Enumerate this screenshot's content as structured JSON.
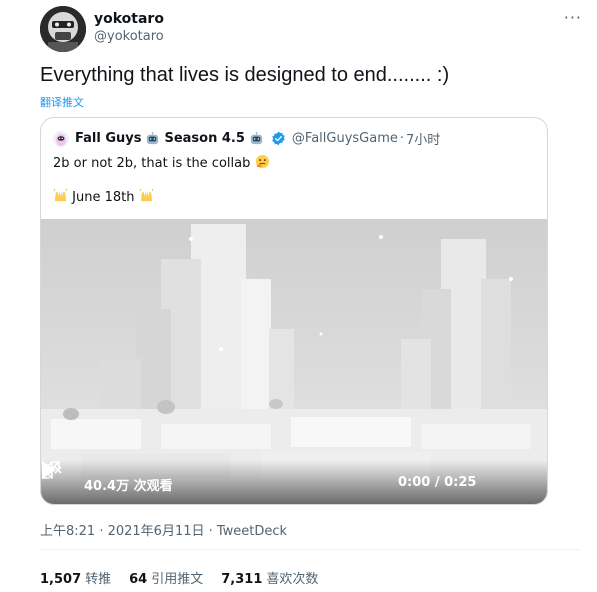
{
  "author": {
    "name": "yokotaro",
    "handle": "@yokotaro",
    "avatar_icon": "mask-avatar-icon",
    "more_icon": "more-dots-icon",
    "more_label": "···"
  },
  "tweet": {
    "text": "Everything that lives is designed to end........ :)",
    "translate_label": "翻译推文"
  },
  "quote": {
    "name_part1": "Fall Guys",
    "name_part2": "Season 4.5",
    "handle": "@FallGuysGame",
    "separator": " · ",
    "time": "7小时",
    "line1": "2b or not 2b, that is the collab",
    "line2": "June 18th",
    "emoji_icons": [
      "robot-emoji",
      "verified-badge-icon",
      "thinking-emoji",
      "raised-hands-emoji"
    ],
    "video": {
      "views": "40.4万 次观看",
      "time": "0:00 / 0:25",
      "play_icon": "play-icon",
      "mute_icon": "mute-icon",
      "expand_icon": "expand-icon"
    }
  },
  "meta": {
    "timestamp": "上午8:21 · 2021年6月11日 · TweetDeck"
  },
  "stats": [
    {
      "count": "1,507",
      "label": "转推"
    },
    {
      "count": "64",
      "label": "引用推文"
    },
    {
      "count": "7,311",
      "label": "喜欢次数"
    }
  ],
  "colors": {
    "link": "#1d9bf0",
    "secondary_text": "#536471",
    "primary_text": "#0f1419",
    "border": "#cfd9de"
  }
}
